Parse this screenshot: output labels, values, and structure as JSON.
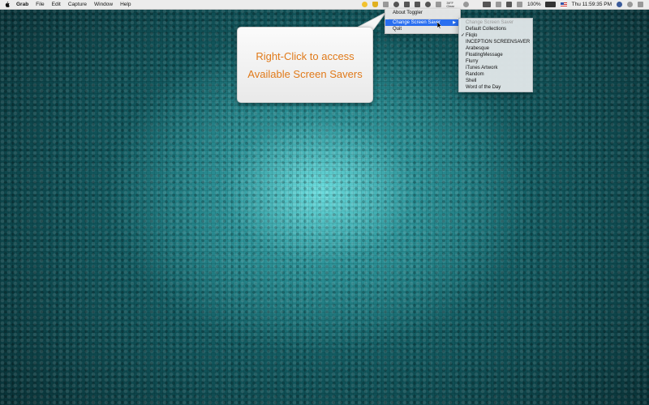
{
  "menubar": {
    "app_name": "Grab",
    "menus": [
      "File",
      "Edit",
      "Capture",
      "Window",
      "Help"
    ],
    "weather_temp": "39°F",
    "weather_detail": "Clear",
    "battery_percent": "100%",
    "battery_level": 1.0,
    "clock": "Thu 11:59:35 PM",
    "icons": [
      "toggler-icon",
      "shield-icon",
      "cloud-sync-icon",
      "eye-icon",
      "box-icon",
      "calendar-icon",
      "cloud-icon",
      "tag-icon",
      "stopwatch-icon",
      "dark-icon",
      "wifi-icon",
      "airplay-icon",
      "volume-icon",
      "flag-icon",
      "user-icon",
      "search-icon",
      "menu-icon"
    ]
  },
  "dropdown": {
    "items": [
      {
        "label": "About Toggler"
      },
      {
        "label": "Change Screen Saver",
        "has_submenu": true,
        "active": true
      },
      {
        "label": "Quit"
      }
    ]
  },
  "submenu": {
    "header": "Change Screen Saver",
    "items": [
      {
        "label": "Default Collections",
        "checked": false
      },
      {
        "label": "Fliqlo",
        "checked": true
      },
      {
        "label": "INCEPTION SCREENSAVER",
        "checked": false
      },
      {
        "label": "Arabesque",
        "checked": false
      },
      {
        "label": "FloatingMessage",
        "checked": false
      },
      {
        "label": "Flurry",
        "checked": false
      },
      {
        "label": "iTunes Artwork",
        "checked": false
      },
      {
        "label": "Random",
        "checked": false
      },
      {
        "label": "Shell",
        "checked": false
      },
      {
        "label": "Word of the Day",
        "checked": false
      }
    ]
  },
  "callout": {
    "line1": "Right-Click to access",
    "line2": "Available Screen Savers",
    "text_color": "#e07a1a"
  },
  "colors": {
    "highlight": "#2a6ff0",
    "desktop": "#11565c"
  }
}
